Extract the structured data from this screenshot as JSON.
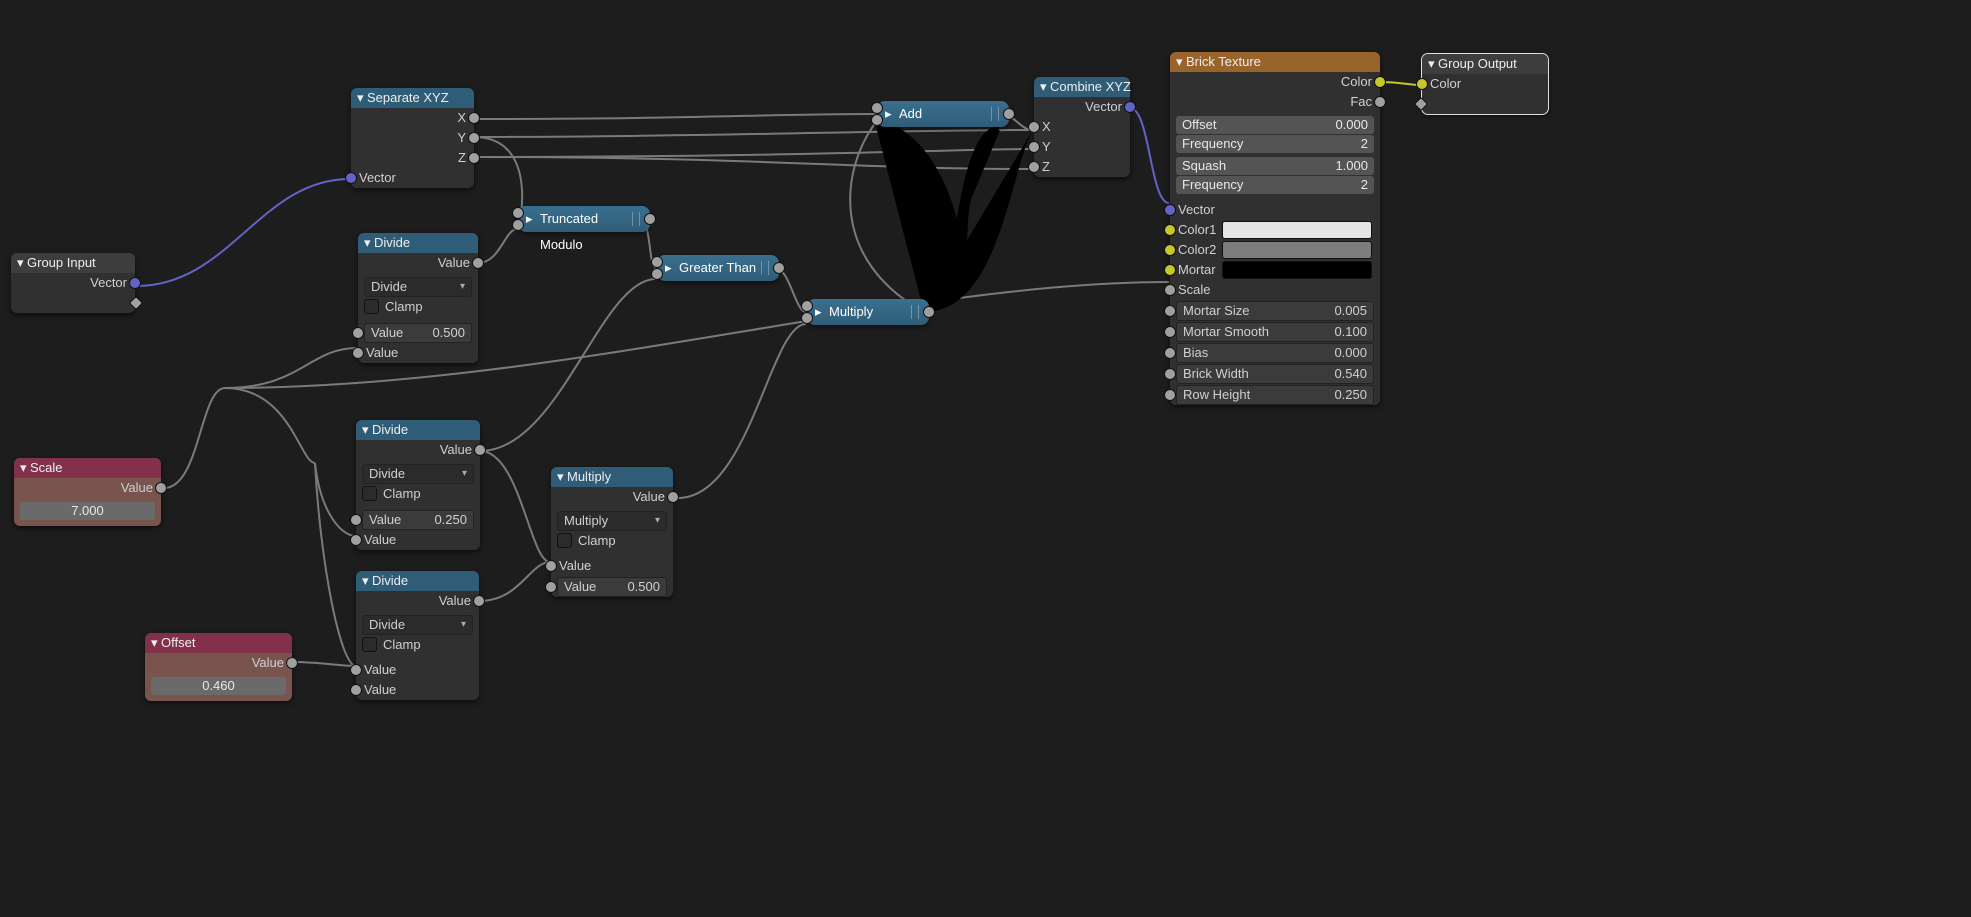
{
  "nodes": {
    "group_input": {
      "title": "Group Input",
      "out_vector": "Vector"
    },
    "group_output": {
      "title": "Group Output",
      "in_color": "Color"
    },
    "scale": {
      "title": "Scale",
      "out": "Value",
      "value": "7.000"
    },
    "offset": {
      "title": "Offset",
      "out": "Value",
      "value": "0.460"
    },
    "separate": {
      "title": "Separate XYZ",
      "x": "X",
      "y": "Y",
      "z": "Z",
      "in_vector": "Vector"
    },
    "combine": {
      "title": "Combine XYZ",
      "out_vector": "Vector",
      "x": "X",
      "y": "Y",
      "z": "Z"
    },
    "divide1": {
      "title": "Divide",
      "op": "Divide",
      "clamp": "Clamp",
      "out": "Value",
      "a_label": "Value",
      "a": "0.500",
      "b": "Value"
    },
    "divide2": {
      "title": "Divide",
      "op": "Divide",
      "clamp": "Clamp",
      "out": "Value",
      "a_label": "Value",
      "a": "0.250",
      "b": "Value"
    },
    "divide3": {
      "title": "Divide",
      "op": "Divide",
      "clamp": "Clamp",
      "out": "Value",
      "a": "Value",
      "b": "Value"
    },
    "multiply_node": {
      "title": "Multiply",
      "op": "Multiply",
      "clamp": "Clamp",
      "out": "Value",
      "a": "Value",
      "b_label": "Value",
      "b": "0.500"
    },
    "trunc_mod": {
      "title": "Truncated Modulo"
    },
    "greater": {
      "title": "Greater Than"
    },
    "add": {
      "title": "Add"
    },
    "multiply_c": {
      "title": "Multiply"
    },
    "brick": {
      "title": "Brick Texture",
      "out_color": "Color",
      "out_fac": "Fac",
      "offset_l": "Offset",
      "offset_v": "0.000",
      "freq1_l": "Frequency",
      "freq1_v": "2",
      "squash_l": "Squash",
      "squash_v": "1.000",
      "freq2_l": "Frequency",
      "freq2_v": "2",
      "vector": "Vector",
      "color1": "Color1",
      "color2": "Color2",
      "mortar": "Mortar",
      "scale": "Scale",
      "msize_l": "Mortar Size",
      "msize_v": "0.005",
      "msmooth_l": "Mortar Smooth",
      "msmooth_v": "0.100",
      "bias_l": "Bias",
      "bias_v": "0.000",
      "bw_l": "Brick Width",
      "bw_v": "0.540",
      "rh_l": "Row Height",
      "rh_v": "0.250"
    }
  },
  "colors": {
    "color1": "#e5e5e5",
    "color2": "#7d7d7d",
    "mortar": "#000000"
  }
}
